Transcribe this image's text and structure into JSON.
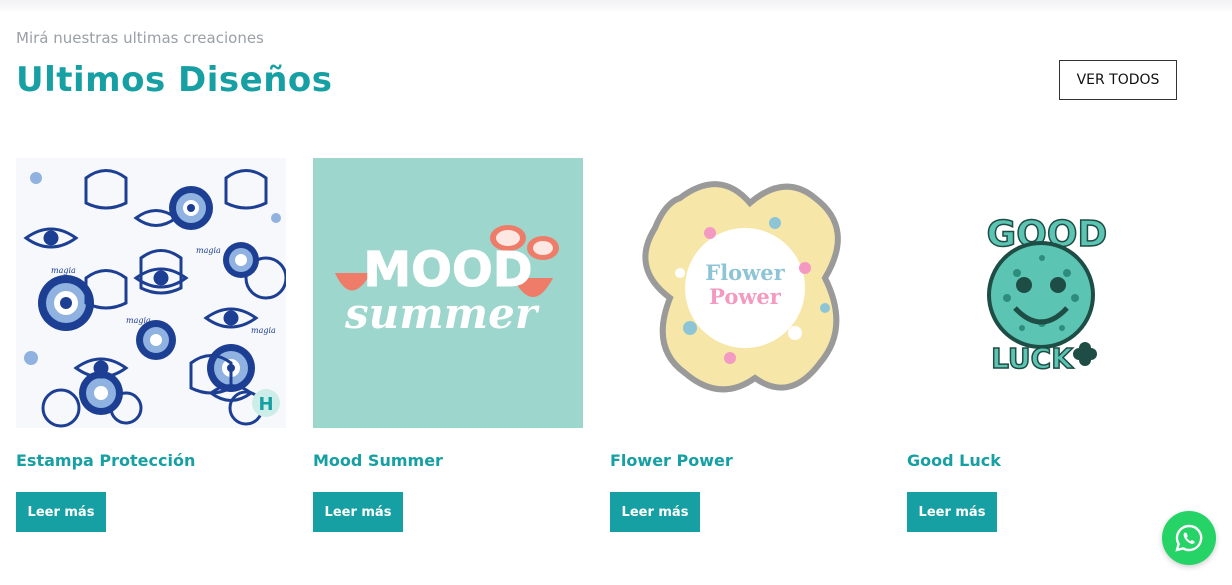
{
  "header": {
    "subtitle": "Mirá nuestras ultimas creaciones",
    "title": "Ultimos Diseños",
    "view_all_label": "VER TODOS"
  },
  "products": [
    {
      "name": "Estampa Protección",
      "button_label": "Leer más",
      "image_icon": "evil-eye-pattern-image",
      "watermark": "H"
    },
    {
      "name": "Mood Summer",
      "button_label": "Leer más",
      "image_icon": "mood-summer-design-image",
      "image_text_top": "MOOD",
      "image_text_bottom": "summer"
    },
    {
      "name": "Flower Power",
      "button_label": "Leer más",
      "image_icon": "flower-power-design-image",
      "image_text_top": "Flower",
      "image_text_bottom": "Power"
    },
    {
      "name": "Good Luck",
      "button_label": "Leer más",
      "image_icon": "good-luck-design-image",
      "image_text_top": "GOOD",
      "image_text_bottom": "LUCK"
    }
  ],
  "floating": {
    "icon": "whatsapp-icon"
  },
  "colors": {
    "accent": "#16a0a3",
    "whatsapp": "#25d366",
    "mint": "#9dd6cc",
    "cream": "#f6e7a8"
  }
}
